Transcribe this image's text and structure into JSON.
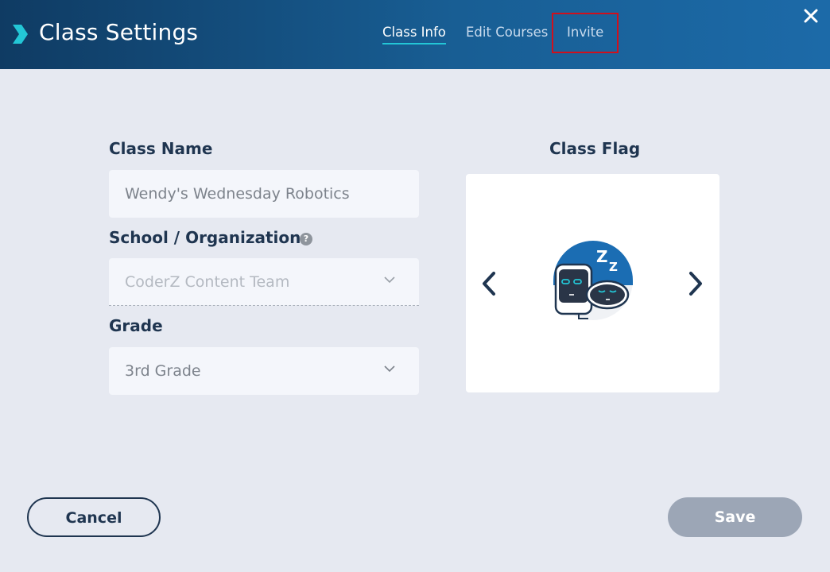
{
  "header": {
    "title": "Class Settings",
    "tabs": [
      {
        "label": "Class Info",
        "active": true
      },
      {
        "label": "Edit Courses",
        "active": false
      },
      {
        "label": "Invite",
        "active": false
      }
    ],
    "highlighted_tab": "Invite",
    "accent_color": "#23c6d6",
    "highlight_color": "#d0101c"
  },
  "form": {
    "class_name": {
      "label": "Class Name",
      "value": "Wendy's Wednesday Robotics"
    },
    "school": {
      "label": "School / Organization",
      "value": "CoderZ Content Team",
      "help_icon": "question-circle-icon",
      "disabled": true
    },
    "grade": {
      "label": "Grade",
      "value": "3rd Grade"
    }
  },
  "flag": {
    "label": "Class Flag",
    "image": "sleeping-robots-zz-icon",
    "prev_icon": "chevron-left-icon",
    "next_icon": "chevron-right-icon"
  },
  "footer": {
    "cancel_label": "Cancel",
    "save_label": "Save"
  },
  "colors": {
    "header_start": "#0f3b63",
    "header_end": "#1c6aa8",
    "background": "#e6e9f1",
    "save_disabled": "#9ca6b6",
    "text_dark": "#1f3550"
  }
}
